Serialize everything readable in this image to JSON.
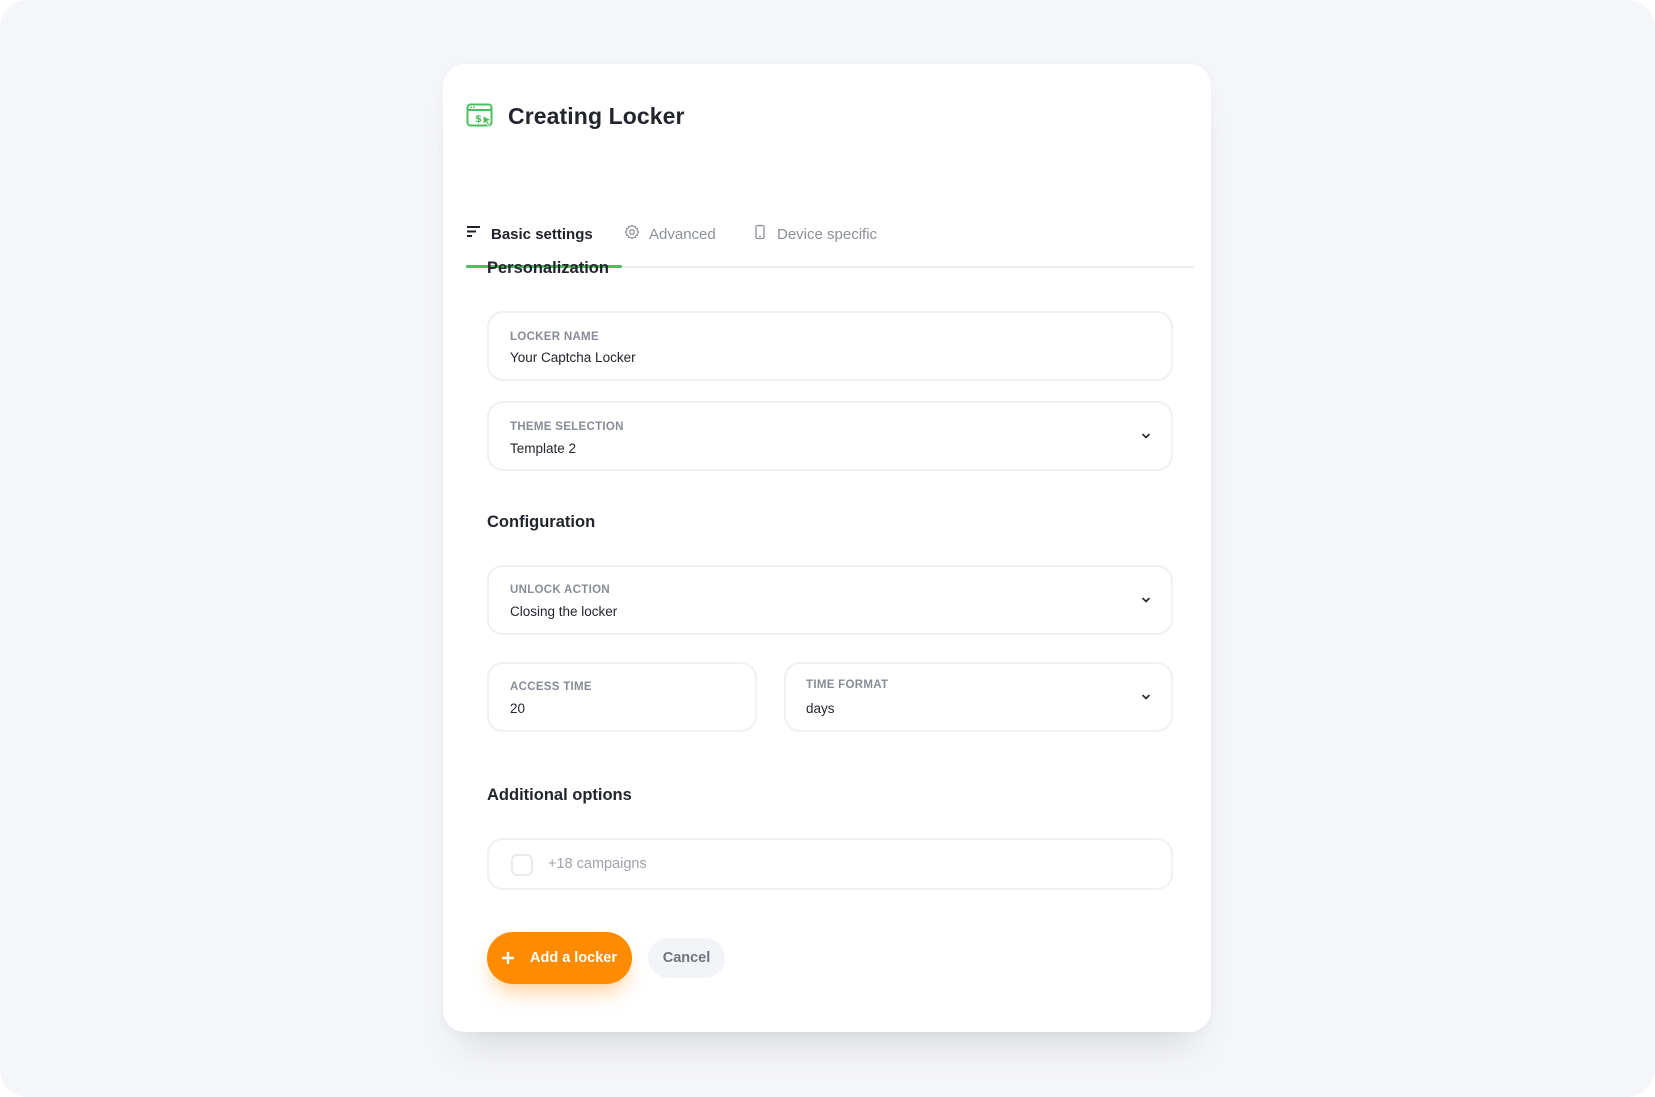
{
  "modal": {
    "title": "Creating Locker",
    "title_icon": "browser-dollar-cursor-icon"
  },
  "tabs": [
    {
      "label": "Basic settings",
      "icon": "menu-lines-icon",
      "active": true
    },
    {
      "label": "Advanced",
      "icon": "gear-icon",
      "active": false
    },
    {
      "label": "Device specific",
      "icon": "mobile-icon",
      "active": false
    }
  ],
  "personalization": {
    "title": "Personalization",
    "locker_name": {
      "label": "LOCKER NAME",
      "value": "Your Captcha Locker"
    },
    "theme_selection": {
      "label": "THEME SELECTION",
      "value": "Template 2"
    }
  },
  "configuration": {
    "title": "Configuration",
    "unlock_action": {
      "label": "UNLOCK ACTION",
      "value": "Closing the locker"
    },
    "access_time": {
      "label": "ACCESS TIME",
      "value": "20"
    },
    "time_format": {
      "label": "TIME FORMAT",
      "value": "days"
    }
  },
  "additional": {
    "title": "Additional options",
    "campaigns": {
      "label": "+18 campaigns",
      "checked": false
    }
  },
  "actions": {
    "add_label": "Add a locker",
    "cancel_label": "Cancel"
  },
  "colors": {
    "accent_green": "#4cbe5d",
    "primary_orange": "#ff8b00",
    "background": "#f5f6f9"
  }
}
